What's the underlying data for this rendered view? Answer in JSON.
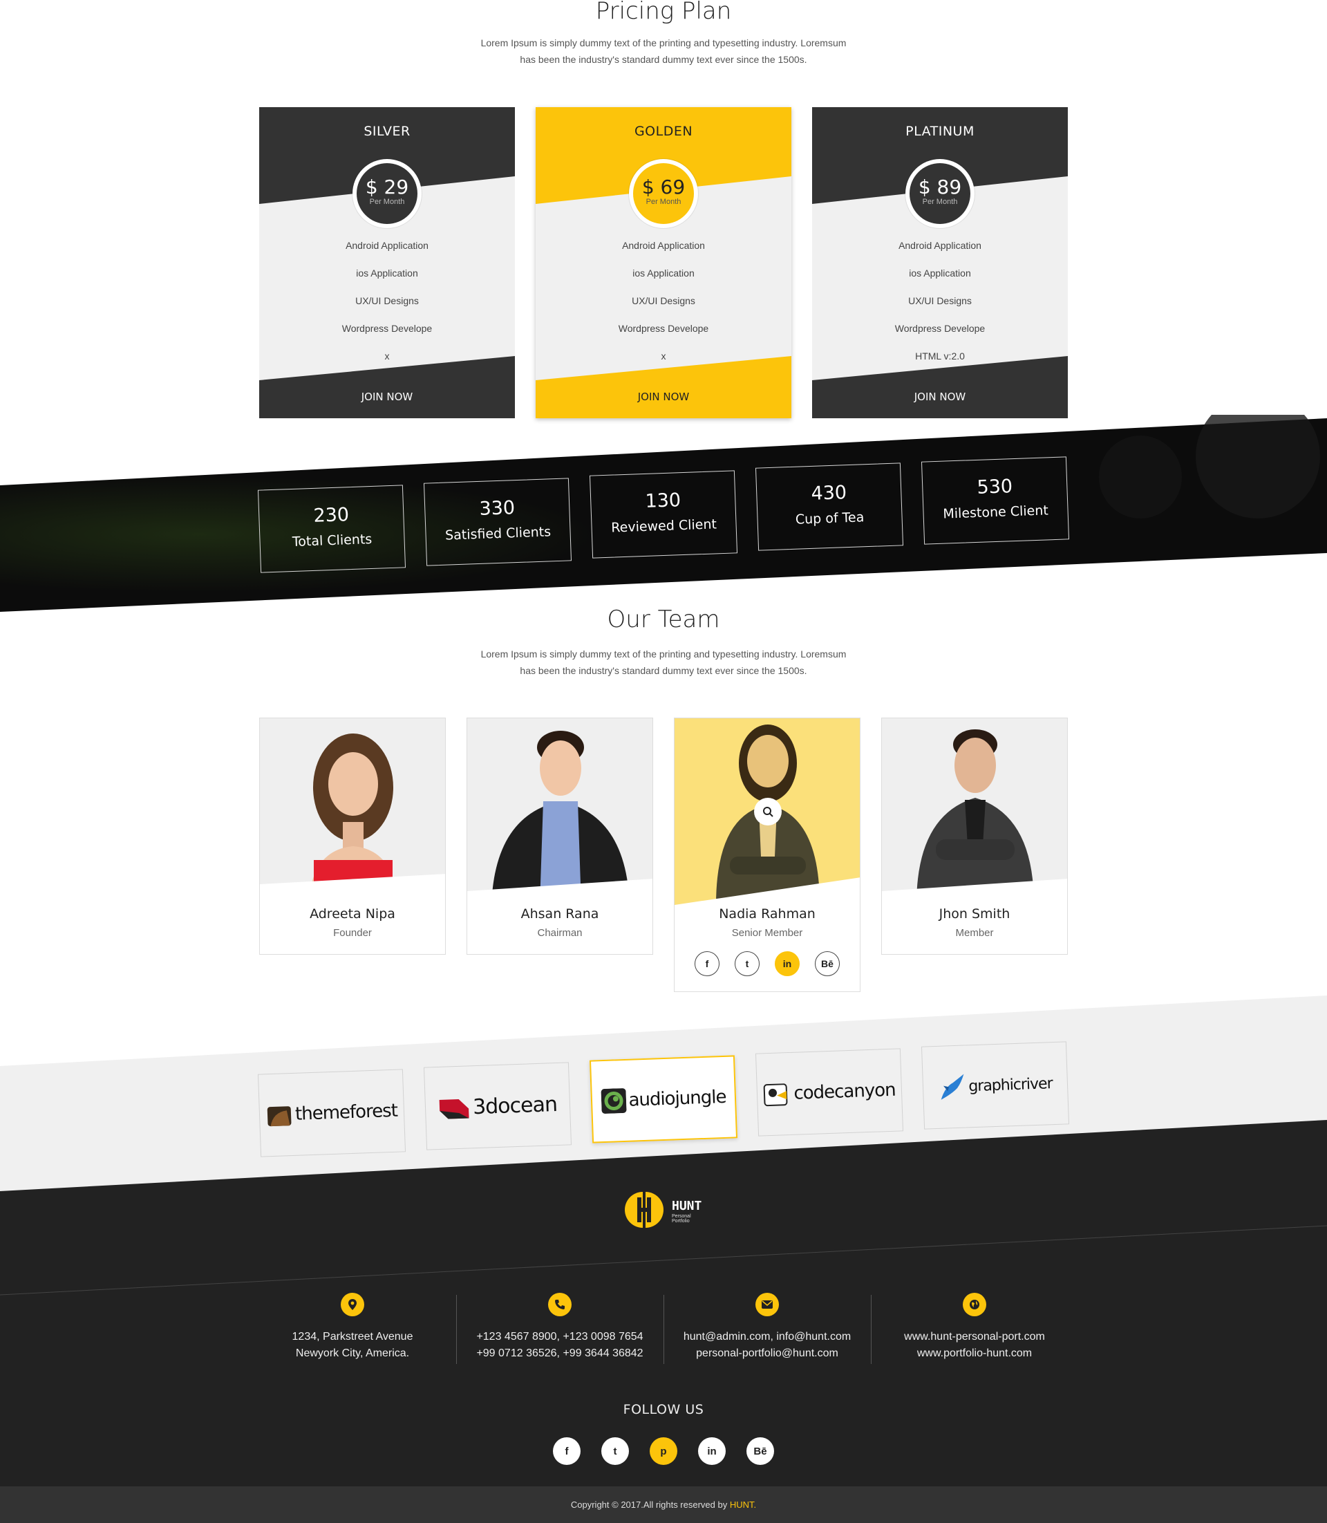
{
  "colors": {
    "accent": "#fcc40b",
    "dark": "#333333",
    "light_panel": "#f0f0f0"
  },
  "pricing": {
    "title": "Pricing Plan",
    "description_line1": "Lorem Ipsum is simply dummy text of the printing and typesetting industry. Loremsum",
    "description_line2": "has been the industry's standard dummy text ever since the 1500s.",
    "plans": [
      {
        "name": "SILVER",
        "price": "$ 29",
        "period": "Per Month",
        "features": [
          "Android Application",
          "ios Application",
          "UX/UI Designs",
          "Wordpress Develope",
          "x"
        ],
        "cta": "JOIN NOW"
      },
      {
        "name": "GOLDEN",
        "price": "$ 69",
        "period": "Per Month",
        "features": [
          "Android Application",
          "ios Application",
          "UX/UI Designs",
          "Wordpress Develope",
          "x"
        ],
        "cta": "JOIN NOW"
      },
      {
        "name": "PLATINUM",
        "price": "$ 89",
        "period": "Per Month",
        "features": [
          "Android Application",
          "ios Application",
          "UX/UI Designs",
          "Wordpress Develope",
          "HTML v:2.0"
        ],
        "cta": "JOIN NOW"
      }
    ]
  },
  "counters": [
    {
      "value": "230",
      "label": "Total Clients"
    },
    {
      "value": "330",
      "label": "Satisfied Clients"
    },
    {
      "value": "130",
      "label": "Reviewed Client"
    },
    {
      "value": "430",
      "label": "Cup of Tea"
    },
    {
      "value": "530",
      "label": "Milestone Client"
    }
  ],
  "team": {
    "title": "Our Team",
    "description_line1": "Lorem Ipsum is simply dummy text of the printing and typesetting industry. Loremsum",
    "description_line2": "has been the industry's standard dummy text ever since the 1500s.",
    "members": [
      {
        "name": "Adreeta Nipa",
        "role": "Founder"
      },
      {
        "name": "Ahsan Rana",
        "role": "Chairman"
      },
      {
        "name": "Nadia Rahman",
        "role": "Senior Member"
      },
      {
        "name": "Jhon Smith",
        "role": "Member"
      }
    ],
    "social_labels": [
      "f",
      "t",
      "in",
      "Bē"
    ]
  },
  "brands": [
    "themeforest",
    "3docean",
    "audiojungle",
    "codecanyon",
    "graphicriver"
  ],
  "footer": {
    "logo_text": "HUNT",
    "logo_subtext": "Personal Portfolio",
    "contacts": [
      {
        "icon": "location-pin-icon",
        "line1": "1234, Parkstreet Avenue",
        "line2": "Newyork City, America."
      },
      {
        "icon": "phone-icon",
        "line1": "+123 4567 8900, +123 0098 7654",
        "line2": "+99 0712 36526, +99 3644 36842"
      },
      {
        "icon": "envelope-icon",
        "line1": "hunt@admin.com, info@hunt.com",
        "line2": "personal-portfolio@hunt.com"
      },
      {
        "icon": "globe-icon",
        "line1": "www.hunt-personal-port.com",
        "line2": "www.portfolio-hunt.com"
      }
    ],
    "follow_title": "FOLLOW US",
    "follow_labels": [
      "f",
      "t",
      "p",
      "in",
      "Bē"
    ],
    "copyright_prefix": "Copyright © 2017.All rights reserved by ",
    "copyright_brand": "HUNT."
  }
}
